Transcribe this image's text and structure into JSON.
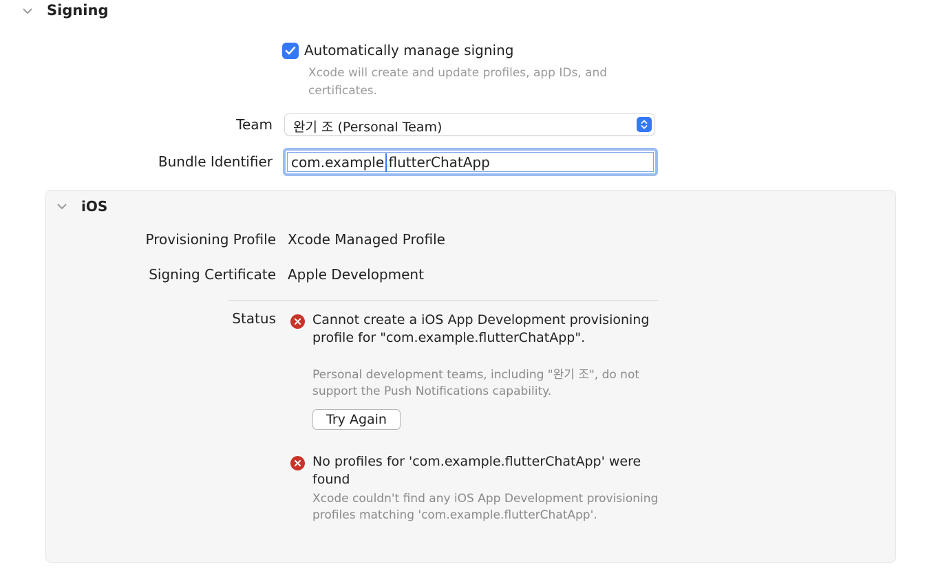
{
  "signing": {
    "title": "Signing",
    "auto_manage_label": "Automatically manage signing",
    "auto_manage_checked": true,
    "auto_manage_help": "Xcode will create and update profiles, app IDs, and certificates.",
    "team_label": "Team",
    "team_value": "완기 조 (Personal Team)",
    "bundle_label": "Bundle Identifier",
    "bundle_value": "com.example.flutterChatApp"
  },
  "ios": {
    "title": "iOS",
    "provisioning_label": "Provisioning Profile",
    "provisioning_value": "Xcode Managed Profile",
    "certificate_label": "Signing Certificate",
    "certificate_value": "Apple Development",
    "status_label": "Status",
    "errors": [
      {
        "title": "Cannot create a iOS App Development provisioning profile for \"com.example.flutterChatApp\".",
        "description": "Personal development teams, including \"완기 조\", do not support the Push Notifications capability.",
        "action_label": "Try Again"
      },
      {
        "title": "No profiles for 'com.example.flutterChatApp' were found",
        "description": "Xcode couldn't find any iOS App Development provisioning profiles matching 'com.example.flutterChatApp'."
      }
    ]
  },
  "colors": {
    "accent": "#3478f6",
    "error": "#c8332a",
    "secondary_text": "#8a8a8a"
  }
}
